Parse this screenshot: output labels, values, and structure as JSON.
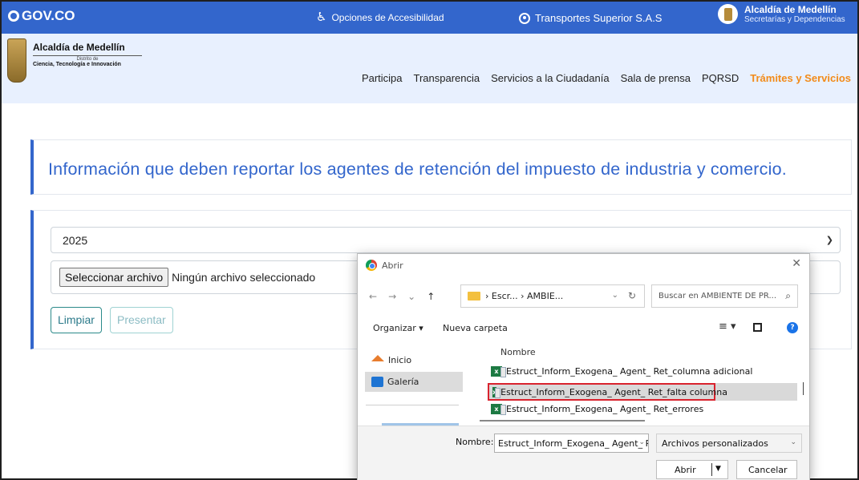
{
  "govbar": {
    "logo": "GOV.CO",
    "accessibility": "Opciones de Accesibilidad",
    "user": "Transportes Superior S.A.S",
    "alcaldia_title": "Alcaldía de Medellín",
    "alcaldia_sub": "Secretarías y Dependencias"
  },
  "brand": {
    "title": "Alcaldía de Medellín",
    "district": "Distrito de",
    "dependency": "Ciencia, Tecnología e Innovación"
  },
  "nav": {
    "items": [
      "Participa",
      "Transparencia",
      "Servicios a la Ciudadanía",
      "Sala de prensa",
      "PQRSD",
      "Trámites y Servicios"
    ]
  },
  "page": {
    "heading": "Información que deben reportar los agentes de retención del impuesto de industria y comercio.",
    "year_select": "2025",
    "file_button": "Seleccionar archivo",
    "file_status": "Ningún archivo seleccionado",
    "btn_clear": "Limpiar",
    "btn_submit": "Presentar"
  },
  "dialog": {
    "title": "Abrir",
    "path": "› Escr... › AMBIE...",
    "search_placeholder": "Buscar en AMBIENTE DE PR...",
    "organize": "Organizar ▾",
    "new_folder": "Nueva carpeta",
    "sidebar": [
      "Inicio",
      "Galería"
    ],
    "column_header": "Nombre",
    "files": [
      "Estruct_Inform_Exogena_ Agent_ Ret_columna adicional",
      "Estruct_Inform_Exogena_ Agent_ Ret_falta columna",
      "Estruct_Inform_Exogena_ Agent_ Ret_errores"
    ],
    "name_label": "Nombre:",
    "name_value": "Estruct_Inform_Exogena_ Agent_ Re",
    "filetype": "Archivos personalizados",
    "open": "Abrir",
    "cancel": "Cancelar"
  },
  "colors": {
    "gov_blue": "#3366cc",
    "nav_bg": "#e8f0fe",
    "active_orange": "#f28b1a",
    "highlight_red": "#d9232e"
  }
}
